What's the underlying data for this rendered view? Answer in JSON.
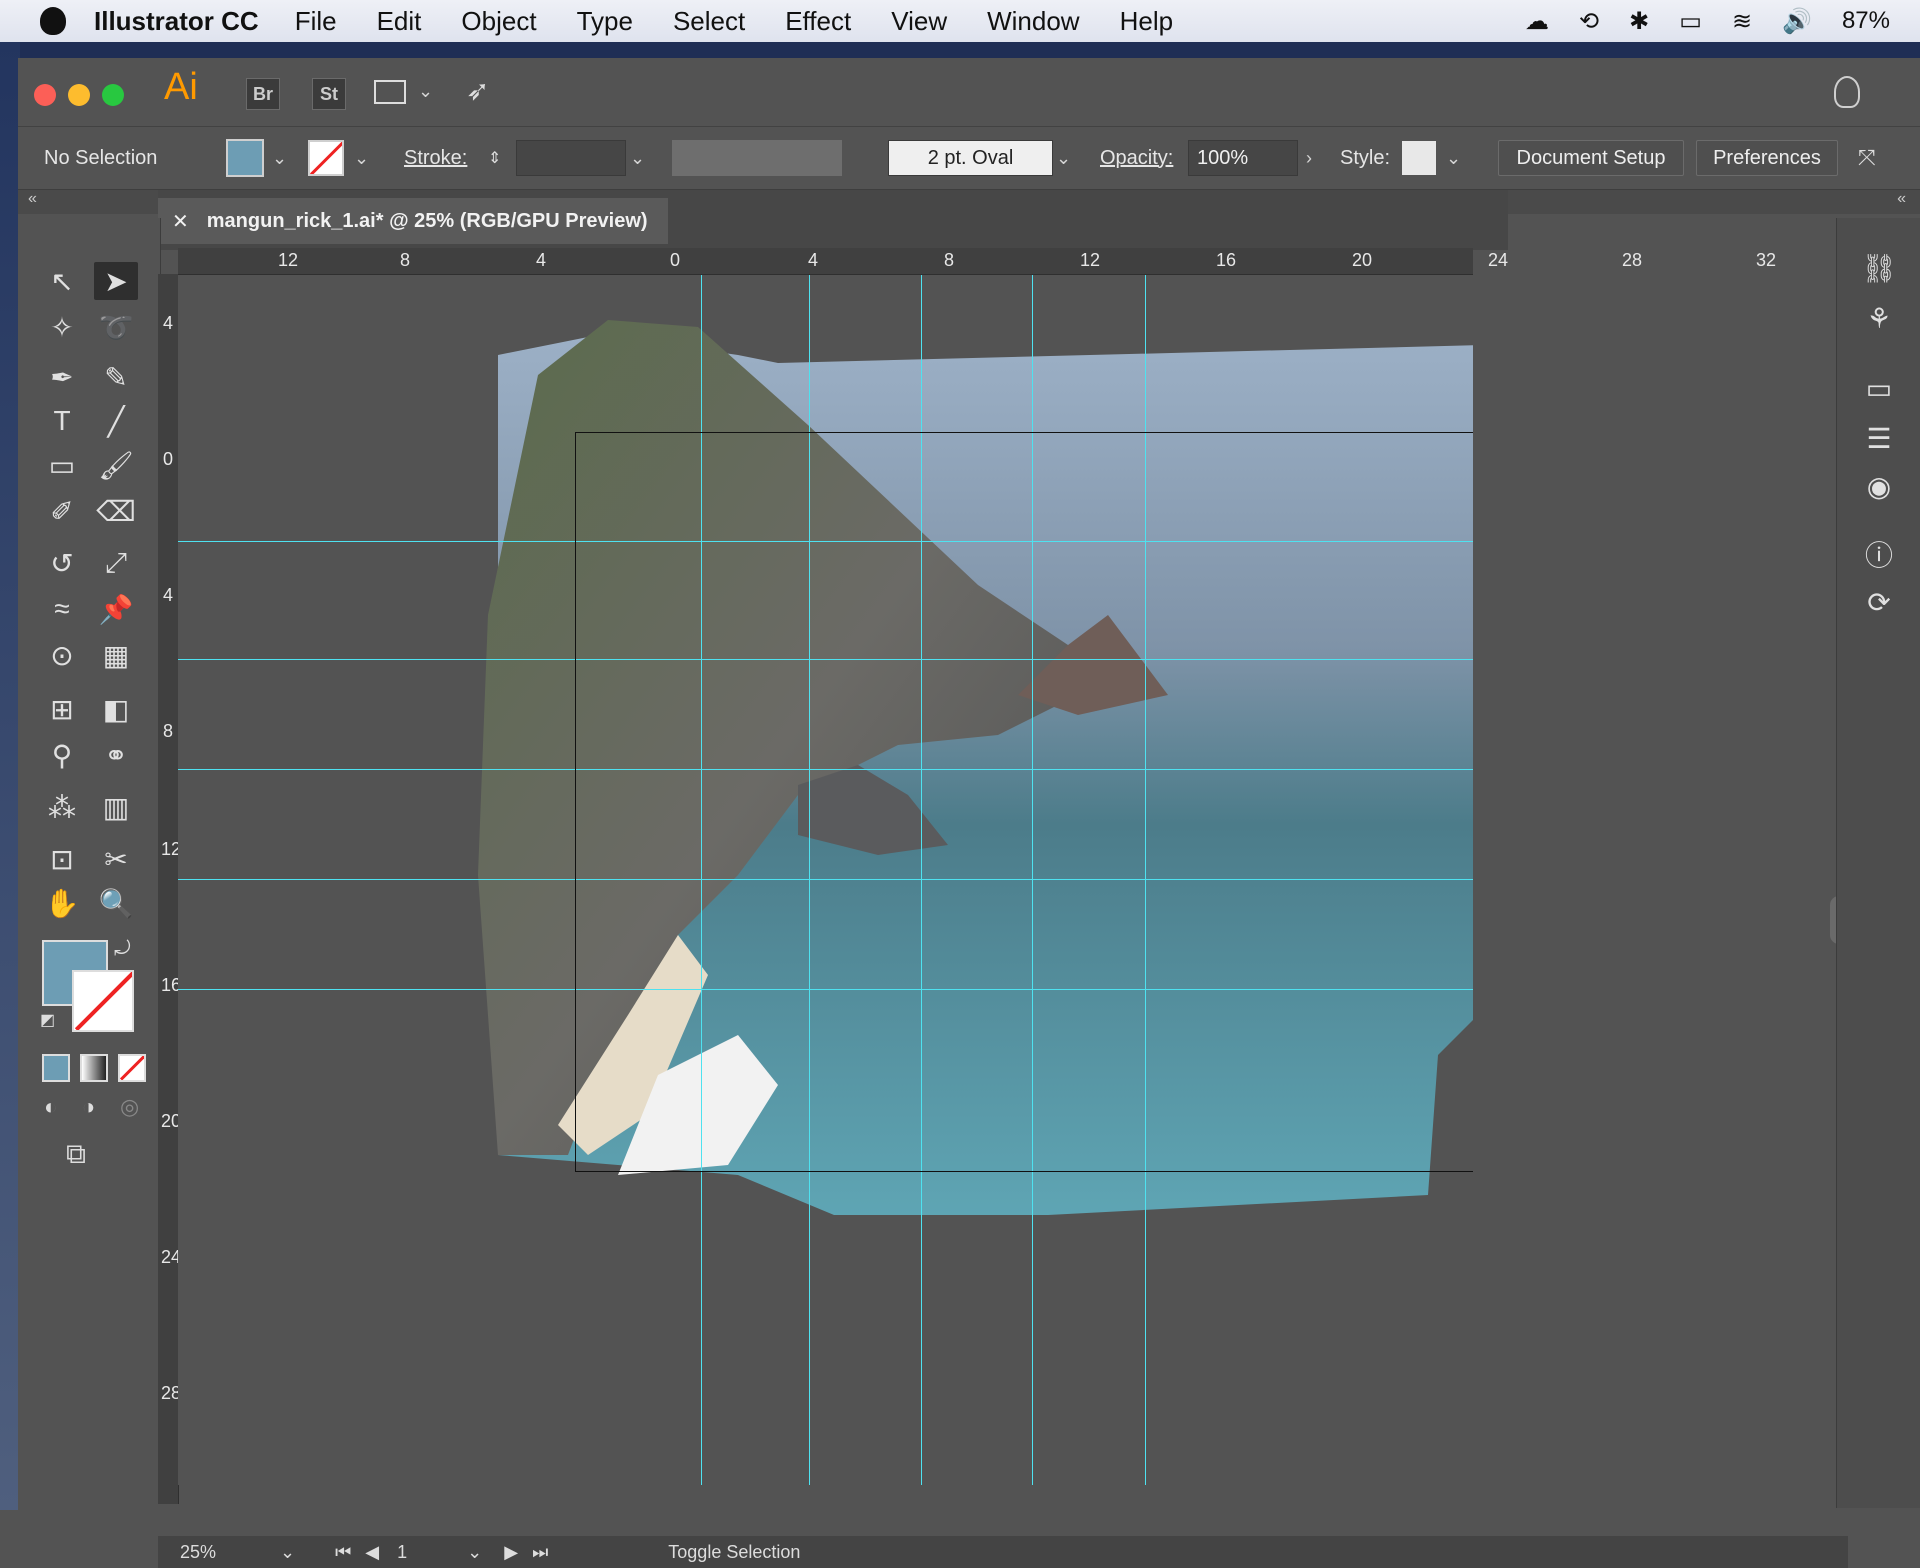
{
  "menubar": {
    "app_name": "Illustrator CC",
    "items": [
      "File",
      "Edit",
      "Object",
      "Type",
      "Select",
      "Effect",
      "View",
      "Window",
      "Help"
    ],
    "battery": "87%"
  },
  "appbar": {
    "logo": "Ai",
    "chips": [
      "Br",
      "St"
    ]
  },
  "control": {
    "selection_label": "No Selection",
    "fill_color": "#6d9db4",
    "stroke_label": "Stroke:",
    "brush_label": "2 pt. Oval",
    "opacity_label": "Opacity:",
    "opacity_value": "100%",
    "style_label": "Style:",
    "document_setup": "Document Setup",
    "preferences": "Preferences"
  },
  "document": {
    "tab_title": "mangun_rick_1.ai* @ 25% (RGB/GPU Preview)"
  },
  "rulers": {
    "horizontal": [
      "12",
      "8",
      "4",
      "0",
      "4",
      "8",
      "12",
      "16",
      "20",
      "24",
      "28",
      "32"
    ],
    "vertical": [
      "4",
      "0",
      "4",
      "8",
      "12",
      "16",
      "20",
      "24",
      "28"
    ]
  },
  "status": {
    "zoom": "25%",
    "page": "1",
    "toggle": "Toggle Selection"
  },
  "colors": {
    "guide": "#4ee2f0",
    "accent_logo": "#ff9a00"
  }
}
